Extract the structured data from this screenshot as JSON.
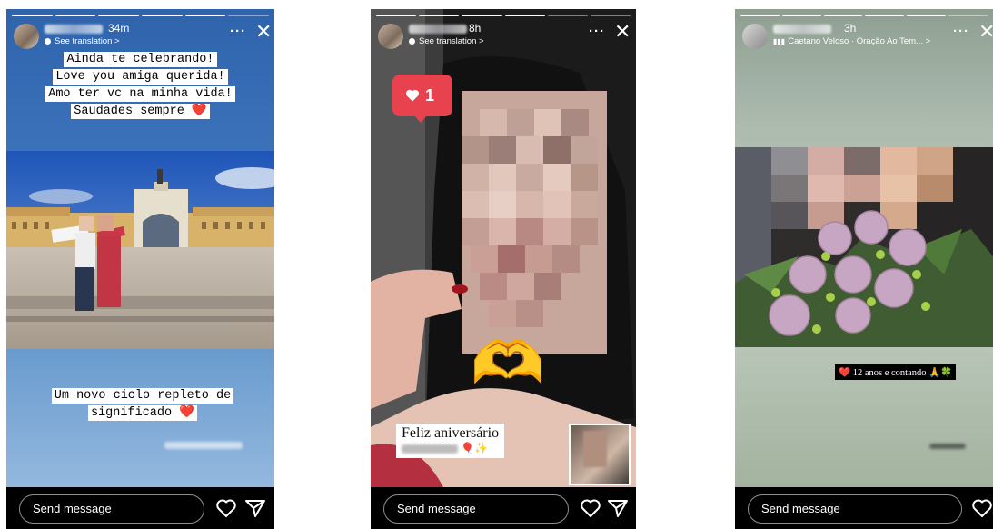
{
  "stories": [
    {
      "time": "34m",
      "subtitle": "See translation >",
      "caption_top": [
        "Ainda te celebrando!",
        "Love you amiga querida!",
        "Amo ter vc na minha vida!",
        "Saudades sempre ❤️"
      ],
      "caption_bottom": [
        "Um novo ciclo repleto de",
        "significado ❤️"
      ],
      "send_placeholder": "Send message"
    },
    {
      "time": "8h",
      "subtitle": "See translation >",
      "like_count": "1",
      "caption": "Feliz aniversário",
      "caption_emoji": "🎈✨",
      "heart_hands_emoji": "🫶",
      "send_placeholder": "Send message"
    },
    {
      "time": "3h",
      "music": "Caetano Veloso · Oração Ao Tem... >",
      "sticker": "❤️ 12 anos e contando 🙏🍀",
      "send_placeholder": "Send message"
    }
  ],
  "icons": {
    "more": "more-icon",
    "close": "close-icon",
    "heart": "heart-icon",
    "share": "send-icon",
    "translate": "translate-icon"
  },
  "colors": {
    "story_bg_1": "#3a6fb8",
    "story_bg_3": "#a9b8a8",
    "like_badge": "#e8424f"
  }
}
